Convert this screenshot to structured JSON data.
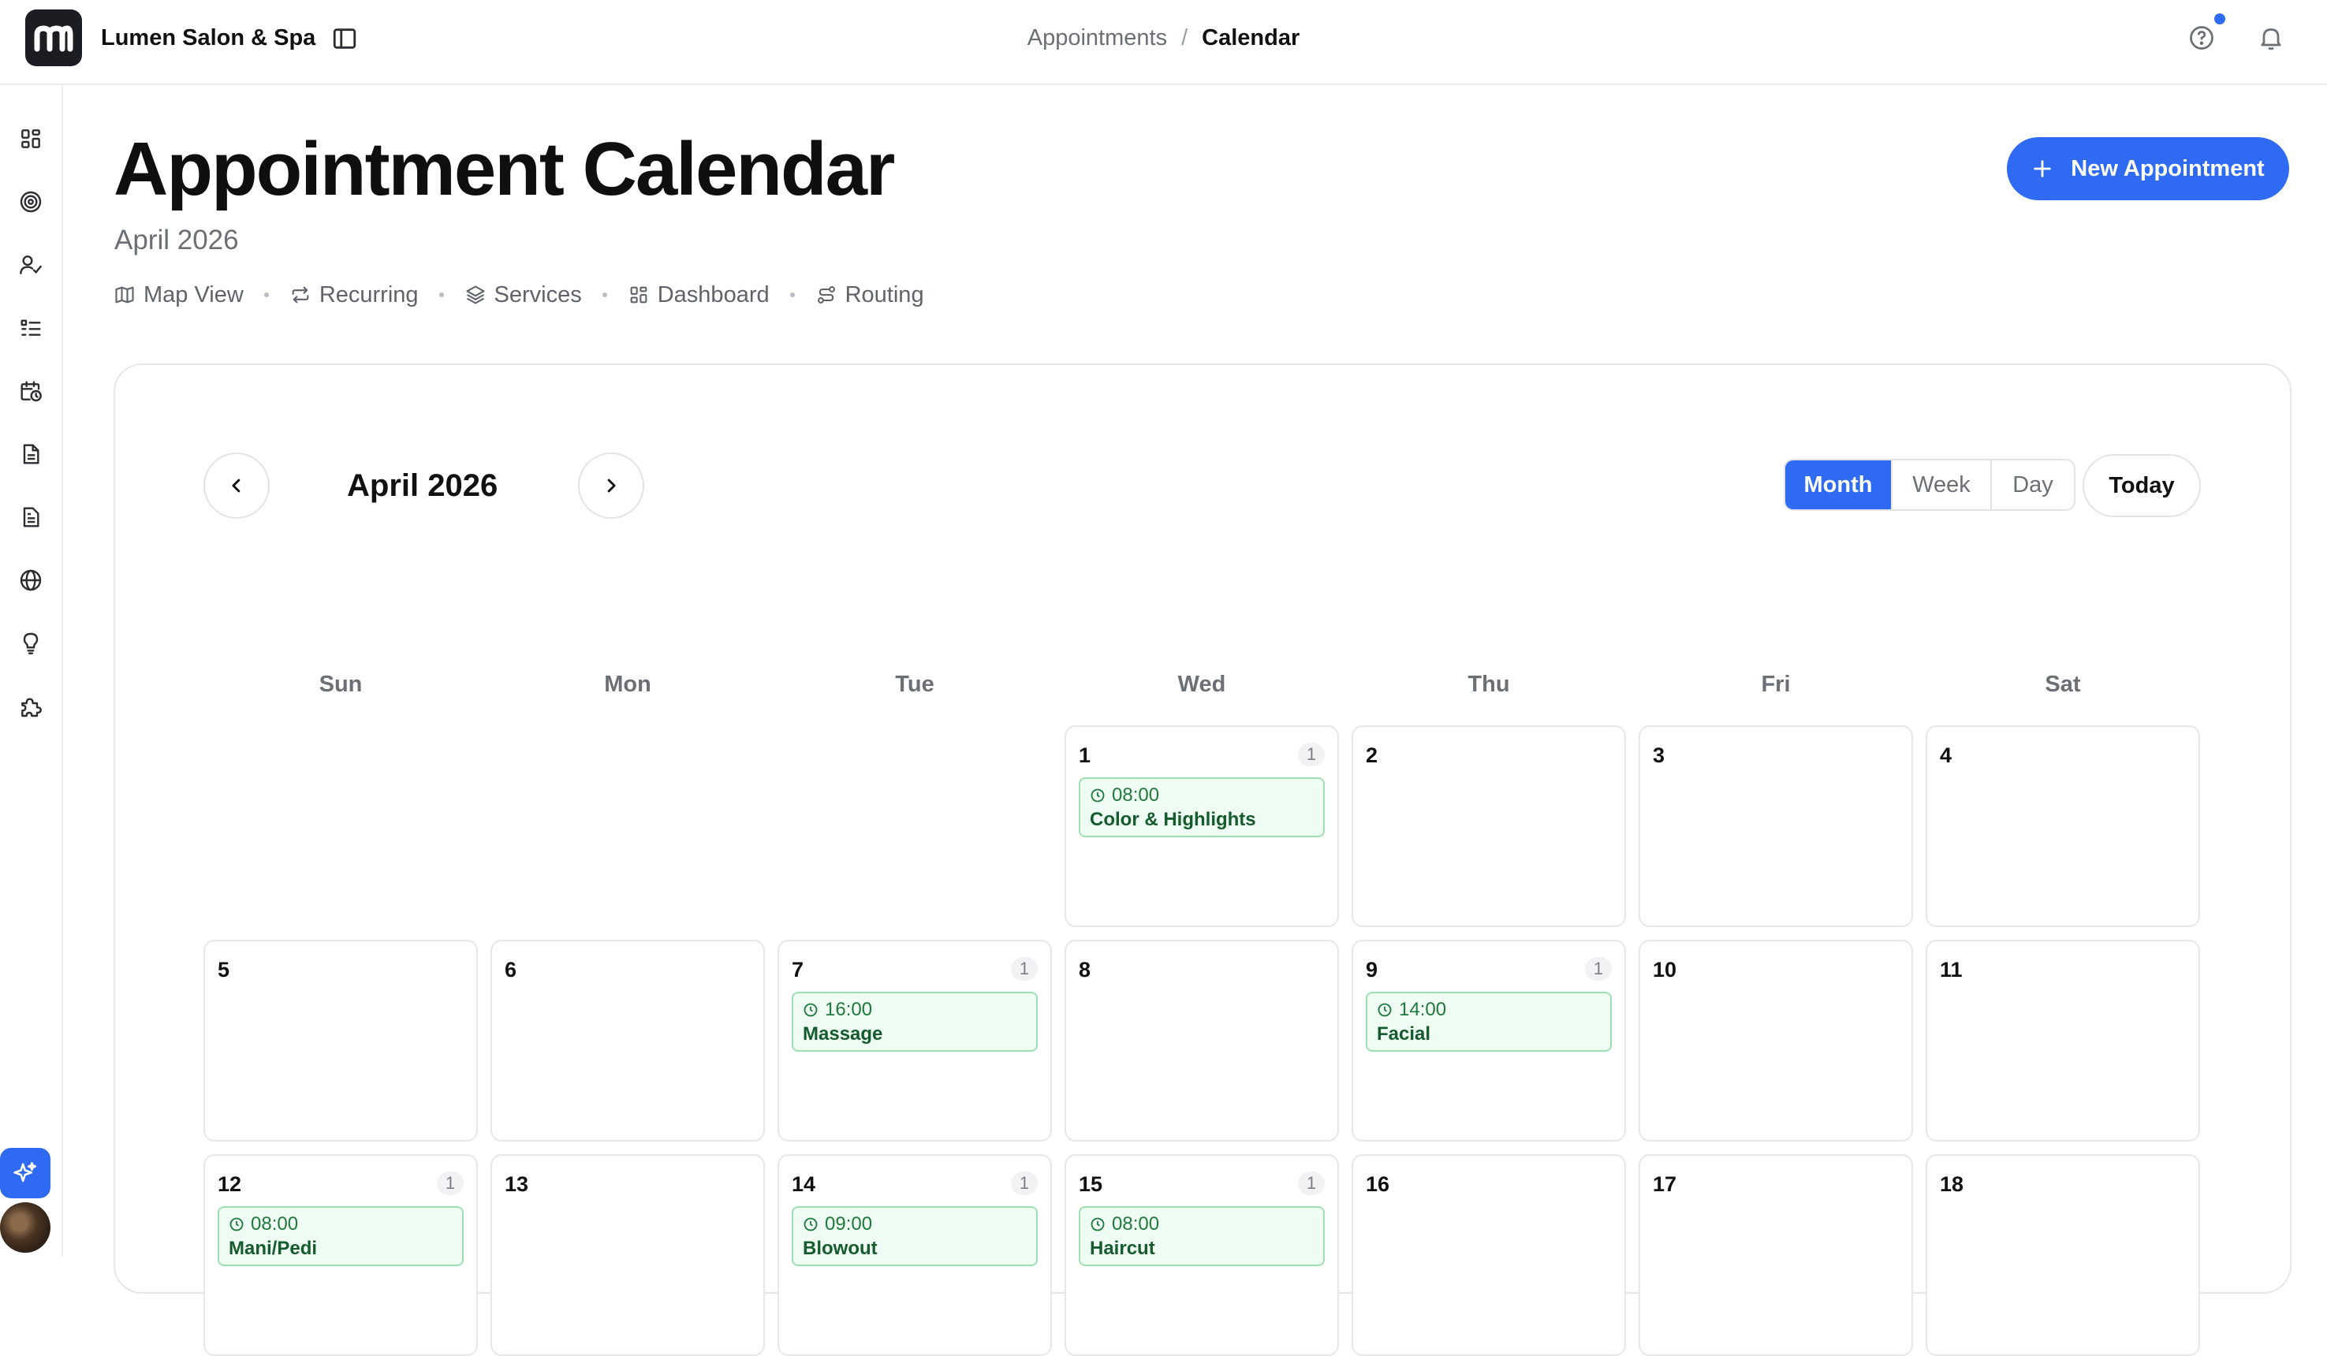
{
  "app": {
    "brand": "Lumen Salon & Spa"
  },
  "breadcrumb": {
    "parent": "Appointments",
    "separator": "/",
    "current": "Calendar"
  },
  "header": {
    "title": "Appointment Calendar",
    "subtitle": "April 2026",
    "new_button_label": "New Appointment"
  },
  "quick_links": [
    {
      "label": "Map View",
      "icon": "map-icon"
    },
    {
      "label": "Recurring",
      "icon": "repeat-icon"
    },
    {
      "label": "Services",
      "icon": "layers-icon"
    },
    {
      "label": "Dashboard",
      "icon": "dashboard-icon"
    },
    {
      "label": "Routing",
      "icon": "route-icon"
    }
  ],
  "calendar": {
    "month_label": "April 2026",
    "views": [
      "Month",
      "Week",
      "Day"
    ],
    "active_view": "Month",
    "today_label": "Today",
    "weekdays": [
      "Sun",
      "Mon",
      "Tue",
      "Wed",
      "Thu",
      "Fri",
      "Sat"
    ],
    "weeks": [
      [
        null,
        null,
        null,
        {
          "day": "1",
          "count": "1",
          "appointments": [
            {
              "time": "08:00",
              "name": "Color & Highlights"
            }
          ]
        },
        {
          "day": "2"
        },
        {
          "day": "3"
        },
        {
          "day": "4"
        }
      ],
      [
        {
          "day": "5"
        },
        {
          "day": "6"
        },
        {
          "day": "7",
          "count": "1",
          "appointments": [
            {
              "time": "16:00",
              "name": "Massage"
            }
          ]
        },
        {
          "day": "8"
        },
        {
          "day": "9",
          "count": "1",
          "appointments": [
            {
              "time": "14:00",
              "name": "Facial"
            }
          ]
        },
        {
          "day": "10"
        },
        {
          "day": "11"
        }
      ],
      [
        {
          "day": "12",
          "count": "1",
          "appointments": [
            {
              "time": "08:00",
              "name": "Mani/Pedi"
            }
          ]
        },
        {
          "day": "13"
        },
        {
          "day": "14",
          "count": "1",
          "appointments": [
            {
              "time": "09:00",
              "name": "Blowout"
            }
          ]
        },
        {
          "day": "15",
          "count": "1",
          "appointments": [
            {
              "time": "08:00",
              "name": "Haircut"
            }
          ]
        },
        {
          "day": "16"
        },
        {
          "day": "17"
        },
        {
          "day": "18"
        }
      ]
    ]
  },
  "sidebar": {
    "icons": [
      "dashboard-icon",
      "target-icon",
      "user-check-icon",
      "list-icon",
      "calendar-clock-icon",
      "document-icon",
      "document-lines-icon",
      "globe-icon",
      "lightbulb-icon",
      "puzzle-icon"
    ],
    "bottom": [
      "sparkle-ai-icon",
      "map-icon",
      "avatar"
    ]
  },
  "colors": {
    "accent": "#2f6bf2",
    "appointment_bg": "#effcf3",
    "appointment_border": "#9fe0b3",
    "appointment_text": "#145c2c"
  }
}
